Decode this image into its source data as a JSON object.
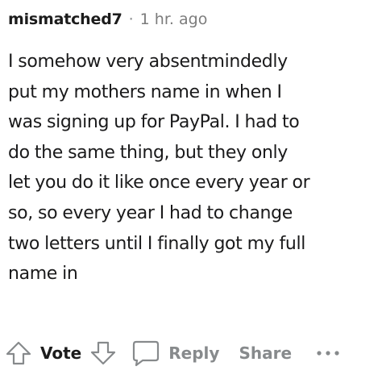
{
  "comment": {
    "author": "mismatched7",
    "separator": "·",
    "time": "1 hr. ago",
    "lines": [
      "I somehow very absentmindedly",
      "put my mothers name in when I",
      "was signing up for PayPal. I had to",
      "do the same thing, but they only",
      "let you do it like once every year or",
      "so, so every year I had to change",
      "two letters until I finally got my full",
      "name in"
    ]
  },
  "actions": {
    "vote_label": "Vote",
    "reply_label": "Reply",
    "share_label": "Share",
    "icons": {
      "upvote": "upvote-arrow-icon",
      "downvote": "downvote-arrow-icon",
      "reply": "speech-bubble-icon",
      "more": "more-dots-icon"
    }
  },
  "colors": {
    "text": "#1a1a1b",
    "muted": "#878a8c",
    "background": "#ffffff"
  }
}
